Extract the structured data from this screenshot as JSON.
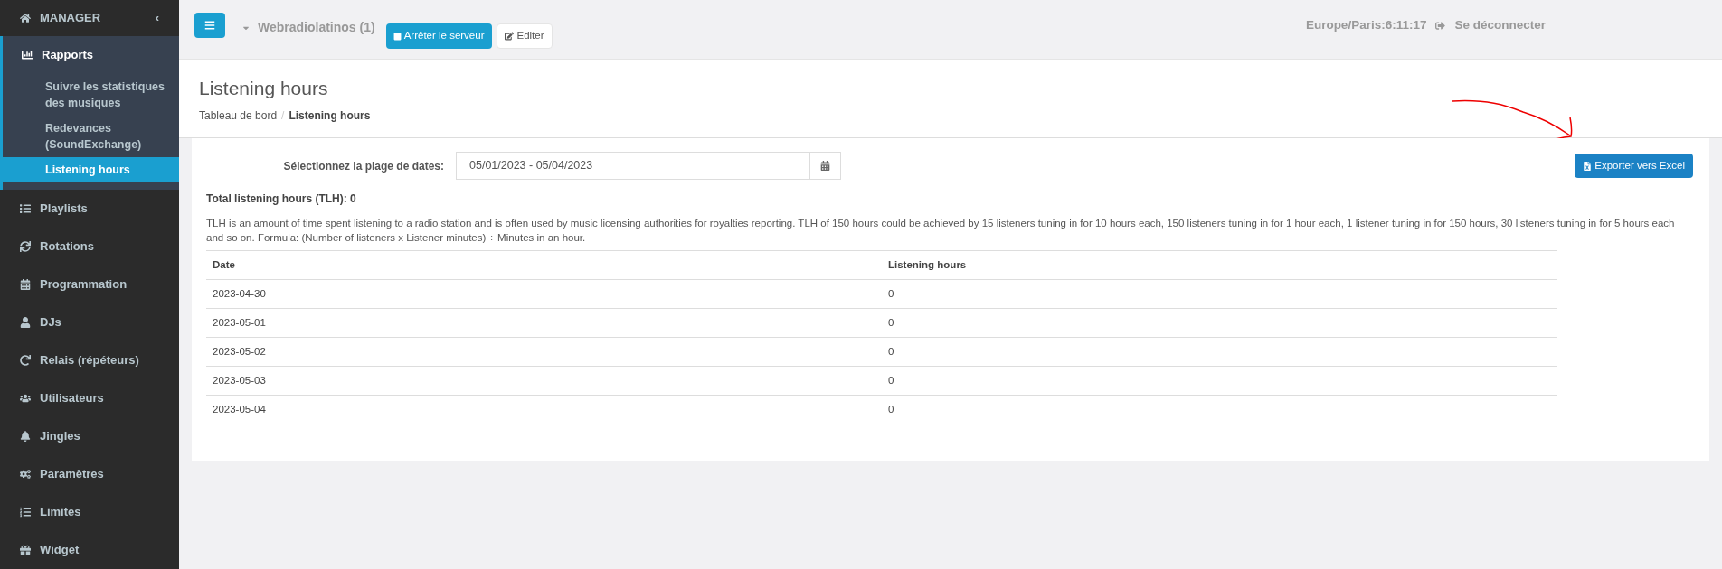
{
  "sidebar": {
    "title": "MANAGER",
    "collapse_glyph": "‹",
    "items": [
      {
        "label": "Rapports",
        "expanded": true,
        "children": [
          {
            "label": "Suivre les statistiques des musiques",
            "selected": false
          },
          {
            "label": "Redevances (SoundExchange)",
            "selected": false
          },
          {
            "label": "Listening hours",
            "selected": true
          }
        ]
      },
      {
        "label": "Playlists"
      },
      {
        "label": "Rotations"
      },
      {
        "label": "Programmation"
      },
      {
        "label": "DJs"
      },
      {
        "label": "Relais (répéteurs)"
      },
      {
        "label": "Utilisateurs"
      },
      {
        "label": "Jingles"
      },
      {
        "label": "Paramètres"
      },
      {
        "label": "Limites"
      },
      {
        "label": "Widget"
      }
    ]
  },
  "topbar": {
    "station": "Webradiolatinos (1)",
    "stop_button": "Arrêter le serveur",
    "edit_button": "Editer",
    "clock": "Europe/Paris:6:11:17",
    "logout": "Se déconnecter"
  },
  "header": {
    "title": "Listening hours",
    "breadcrumb_separator": "/",
    "breadcrumb": [
      {
        "label": "Tableau de bord",
        "current": false
      },
      {
        "label": "Listening hours",
        "current": true
      }
    ]
  },
  "content": {
    "date_label": "Sélectionnez la plage de dates:",
    "date_value": "05/01/2023 - 05/04/2023",
    "export_button": "Exporter vers Excel",
    "total": "Total listening hours (TLH): 0",
    "description": "TLH is an amount of time spent listening to a radio station and is often used by music licensing authorities for royalties reporting. TLH of 150 hours could be achieved by 15 listeners tuning in for 10 hours each, 150 listeners tuning in for 1 hour each, 1 listener tuning in for 150 hours, 30 listeners tuning in for 5 hours each and so on. Formula: (Number of listeners x Listener minutes) ÷ Minutes in an hour.",
    "table": {
      "columns": [
        "Date",
        "Listening hours"
      ],
      "rows": [
        [
          "2023-04-30",
          "0"
        ],
        [
          "2023-05-01",
          "0"
        ],
        [
          "2023-05-02",
          "0"
        ],
        [
          "2023-05-03",
          "0"
        ],
        [
          "2023-05-04",
          "0"
        ]
      ]
    }
  }
}
